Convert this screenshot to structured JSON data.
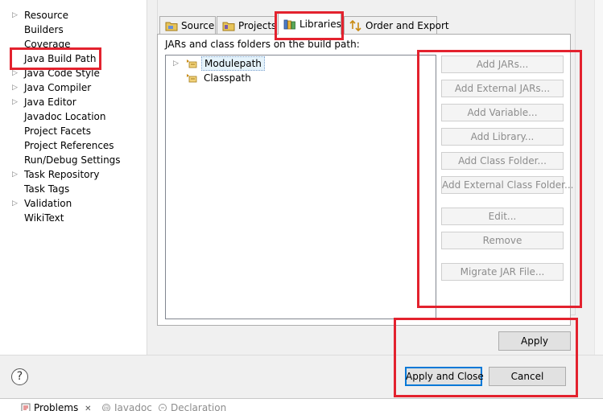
{
  "nav": {
    "items": [
      {
        "label": "Resource",
        "expandable": true
      },
      {
        "label": "Builders",
        "expandable": false
      },
      {
        "label": "Coverage",
        "expandable": false
      },
      {
        "label": "Java Build Path",
        "expandable": false,
        "selected": true
      },
      {
        "label": "Java Code Style",
        "expandable": true
      },
      {
        "label": "Java Compiler",
        "expandable": true
      },
      {
        "label": "Java Editor",
        "expandable": true
      },
      {
        "label": "Javadoc Location",
        "expandable": false
      },
      {
        "label": "Project Facets",
        "expandable": false
      },
      {
        "label": "Project References",
        "expandable": false
      },
      {
        "label": "Run/Debug Settings",
        "expandable": false
      },
      {
        "label": "Task Repository",
        "expandable": true
      },
      {
        "label": "Task Tags",
        "expandable": false
      },
      {
        "label": "Validation",
        "expandable": true
      },
      {
        "label": "WikiText",
        "expandable": false
      }
    ]
  },
  "tabs": [
    {
      "label": "Source",
      "icon": "source-folder-icon"
    },
    {
      "label": "Projects",
      "icon": "projects-folder-icon"
    },
    {
      "label": "Libraries",
      "icon": "libraries-icon",
      "active": true
    },
    {
      "label": "Order and Export",
      "icon": "order-export-icon"
    }
  ],
  "libraries": {
    "section_label": "JARs and class folders on the build path:",
    "tree": [
      {
        "label": "Modulepath",
        "expandable": true,
        "selected": true
      },
      {
        "label": "Classpath",
        "expandable": false
      }
    ],
    "buttons": {
      "add_jars": "Add JARs...",
      "add_external_jars": "Add External JARs...",
      "add_variable": "Add Variable...",
      "add_library": "Add Library...",
      "add_class_folder": "Add Class Folder...",
      "add_external_class_folder": "Add External Class Folder...",
      "edit": "Edit...",
      "remove": "Remove",
      "migrate_jar": "Migrate JAR File..."
    }
  },
  "footer": {
    "apply": "Apply",
    "apply_and_close": "Apply and Close",
    "cancel": "Cancel",
    "help_glyph": "?"
  },
  "views": [
    {
      "label": "Problems",
      "icon": "problems-icon",
      "close_glyph": "✕"
    },
    {
      "label": "Javadoc",
      "icon": "javadoc-icon"
    },
    {
      "label": "Declaration",
      "icon": "declaration-icon"
    }
  ],
  "colors": {
    "highlight": "#e3222e",
    "selection": "#e5f3fb",
    "default_button_border": "#0078d7",
    "disabled_text": "#8d8d8d"
  }
}
